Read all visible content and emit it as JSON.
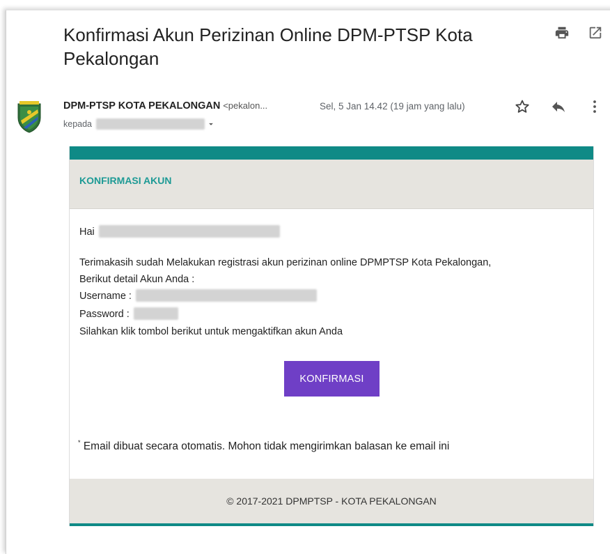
{
  "email": {
    "subject": "Konfirmasi Akun Perizinan Online DPM-PTSP Kota Pekalongan",
    "sender_name": "DPM-PTSP KOTA PEKALONGAN",
    "sender_email": "<pekalon...",
    "date": "Sel, 5 Jan 14.42 (19 jam yang lalu)",
    "recipient_label": "kepada"
  },
  "icons": {
    "print": "printer-icon",
    "open_new_window": "open-in-new-icon",
    "star": "star-icon",
    "reply": "reply-icon",
    "more": "more-vert-icon",
    "recipient_dropdown": "caret-down-icon"
  },
  "card": {
    "title": "KONFIRMASI AKUN",
    "greeting": "Hai",
    "line1": "Terimakasih sudah Melakukan registrasi akun perizinan online DPMPTSP Kota Pekalongan,",
    "line2": "Berikut detail Akun Anda :",
    "username_label": "Username :",
    "password_label": "Password :",
    "line3": "Silahkan klik tombol berikut untuk mengaktifkan akun Anda",
    "button_label": "KONFIRMASI",
    "note_mark": "*",
    "note": "Email dibuat secara otomatis. Mohon tidak mengirimkan balasan ke email ini",
    "footer": "© 2017-2021 DPMPTSP - KOTA PEKALONGAN"
  },
  "colors": {
    "teal": "#0f8a86",
    "teal_text": "#1d9a95",
    "header_bg": "#e6e4df",
    "button_bg": "#6f3fc6"
  }
}
